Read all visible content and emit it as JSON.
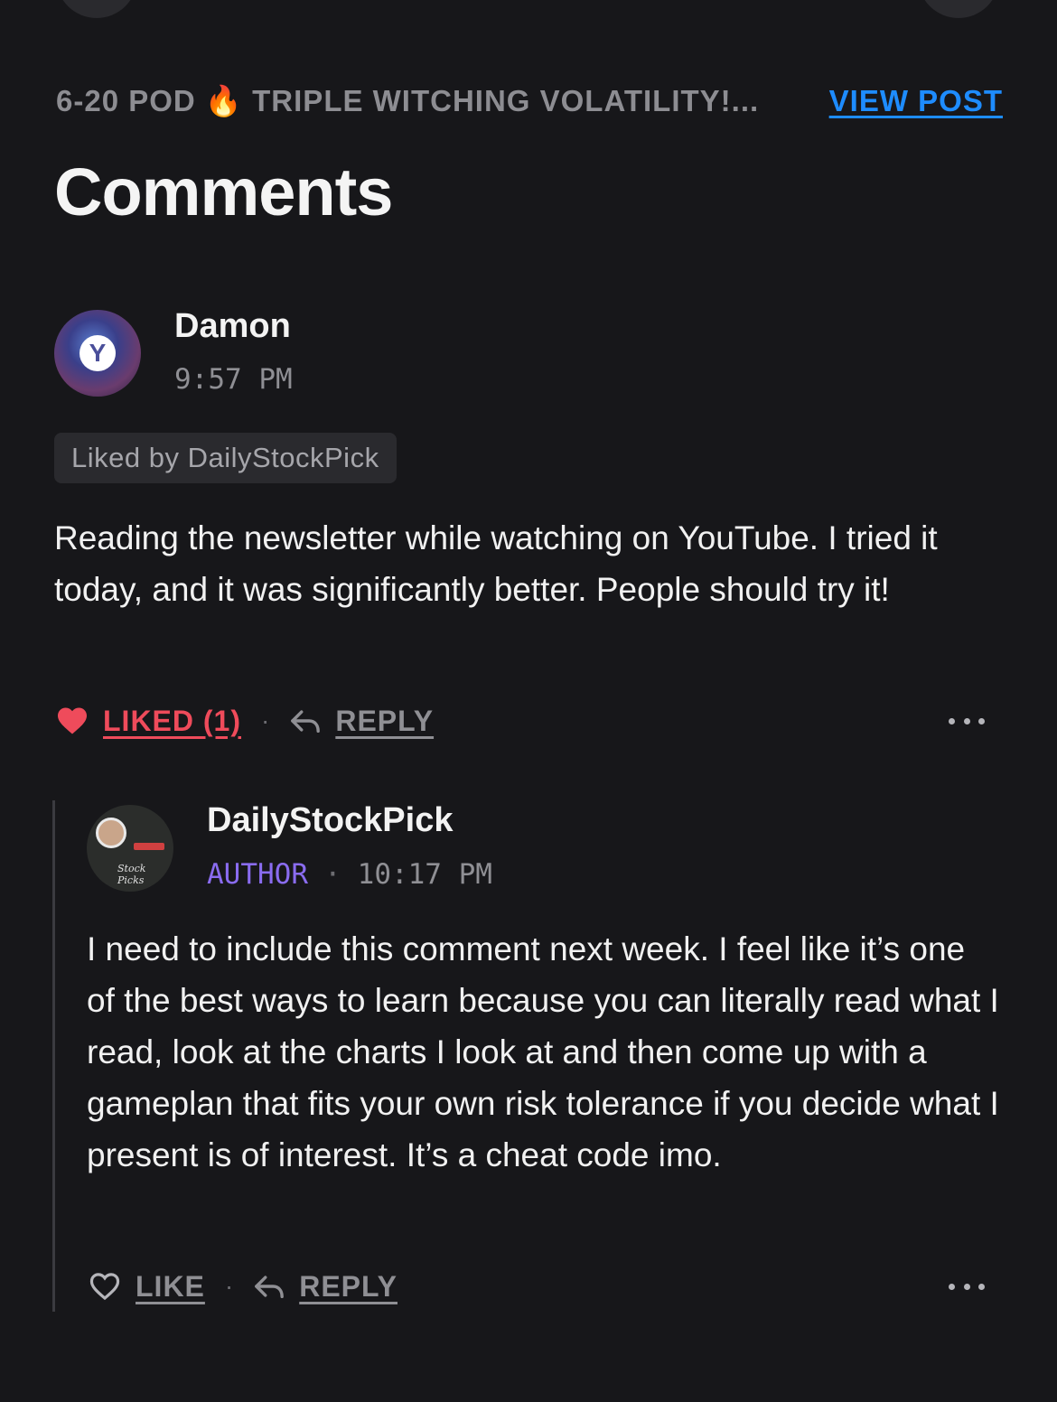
{
  "header": {
    "post_title": "6-20 POD 🔥 TRIPLE WITCHING VOLATILITY!...",
    "view_post_label": "VIEW POST"
  },
  "section_title": "Comments",
  "comments": [
    {
      "author": "Damon",
      "time": "9:57 PM",
      "liked_by": "Liked by DailyStockPick",
      "body": "Reading the newsletter while watching on YouTube. I tried it today, and it was significantly better. People should try it!",
      "like_label": "LIKED (1)",
      "reply_label": "REPLY",
      "liked": true
    },
    {
      "author": "DailyStockPick",
      "role": "AUTHOR",
      "time": "10:17 PM",
      "body": "I need to include this comment next week. I feel like it’s one of the best ways to learn because you can literally read what I read, look at the charts I look at and then come up with a gameplan that fits your own risk tolerance if you decide what I present is of interest. It’s a cheat code imo.",
      "like_label": "LIKE",
      "reply_label": "REPLY",
      "liked": false,
      "avatar_text": "Stock Picks"
    }
  ],
  "colors": {
    "background": "#17171a",
    "link_blue": "#1e8cff",
    "liked_red": "#ef4b5b",
    "author_purple": "#8a6cf0"
  },
  "icons": {
    "like_filled": "heart-filled-icon",
    "like_outline": "heart-outline-icon",
    "reply": "reply-arrow-icon",
    "more": "more-dots-icon"
  }
}
